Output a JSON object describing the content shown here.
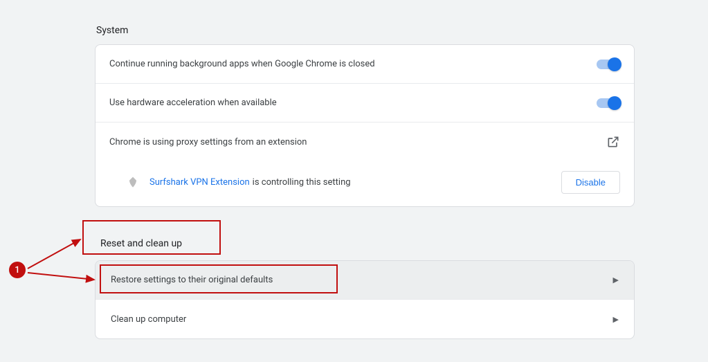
{
  "system": {
    "title": "System",
    "bg_apps_label": "Continue running background apps when Google Chrome is closed",
    "hw_accel_label": "Use hardware acceleration when available",
    "proxy_label": "Chrome is using proxy settings from an extension",
    "extension_name": "Surfshark VPN Extension",
    "extension_msg": "is controlling this setting",
    "disable_label": "Disable"
  },
  "reset": {
    "title": "Reset and clean up",
    "restore_label": "Restore settings to their original defaults",
    "cleanup_label": "Clean up computer"
  },
  "annotation": {
    "number": "1"
  }
}
